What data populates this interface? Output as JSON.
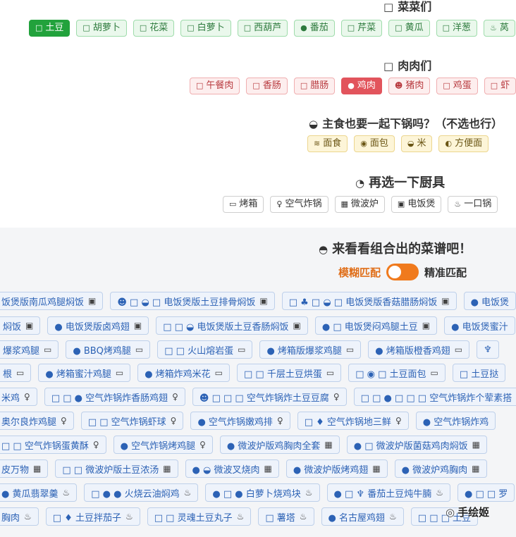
{
  "vegetables": {
    "title": "菜菜们",
    "title_icon": "□",
    "items": [
      {
        "label": "土豆",
        "icon": "□",
        "active": true
      },
      {
        "label": "胡萝卜",
        "icon": "□"
      },
      {
        "label": "花菜",
        "icon": "□"
      },
      {
        "label": "白萝卜",
        "icon": "□"
      },
      {
        "label": "西葫芦",
        "icon": "□"
      },
      {
        "label": "番茄",
        "icon": "●"
      },
      {
        "label": "芹菜",
        "icon": "□"
      },
      {
        "label": "黄瓜",
        "icon": "□"
      },
      {
        "label": "洋葱",
        "icon": "□"
      },
      {
        "label": "莴",
        "icon": "♨"
      }
    ]
  },
  "meats": {
    "title": "肉肉们",
    "title_icon": "□",
    "items": [
      {
        "label": "午餐肉",
        "icon": "□"
      },
      {
        "label": "香肠",
        "icon": "□"
      },
      {
        "label": "腊肠",
        "icon": "□"
      },
      {
        "label": "鸡肉",
        "icon": "●",
        "active": true
      },
      {
        "label": "猪肉",
        "icon": "☻"
      },
      {
        "label": "鸡蛋",
        "icon": "□"
      },
      {
        "label": "虾",
        "icon": "□"
      }
    ]
  },
  "staples": {
    "title": "主食也要一起下锅吗？（不选也行）",
    "title_icon": "◒",
    "items": [
      {
        "label": "面食",
        "icon": "≋"
      },
      {
        "label": "面包",
        "icon": "◉"
      },
      {
        "label": "米",
        "icon": "◒"
      },
      {
        "label": "方便面",
        "icon": "◐"
      }
    ]
  },
  "tools": {
    "title": "再选一下厨具",
    "title_icon": "◔",
    "items": [
      {
        "label": "烤箱",
        "icon": "▭"
      },
      {
        "label": "空气炸锅",
        "icon": "♀"
      },
      {
        "label": "微波炉",
        "icon": "▦"
      },
      {
        "label": "电饭煲",
        "icon": "▣"
      },
      {
        "label": "一口锅",
        "icon": "♨"
      }
    ]
  },
  "results": {
    "title": "来看看组合出的菜谱吧！",
    "title_icon": "◓",
    "toggle_left": "模糊匹配",
    "toggle_right": "精准匹配",
    "rows": [
      [
        {
          "label": "饭煲版南瓜鸡腿焖饭",
          "tail": "▣"
        },
        {
          "label": "☻ □ ◒ □ 电饭煲版土豆排骨焖饭",
          "tail": "▣"
        },
        {
          "label": "□ ♣ □ ◒ □ 电饭煲版香菇腊肠焖饭",
          "tail": "▣"
        },
        {
          "label": "● 电饭煲",
          "tail": ""
        }
      ],
      [
        {
          "label": "焖饭",
          "tail": "▣"
        },
        {
          "label": "● 电饭煲版卤鸡翅",
          "tail": "▣"
        },
        {
          "label": "□ □ ◒ 电饭煲版土豆香肠焖饭",
          "tail": "▣"
        },
        {
          "label": "● □ 电饭煲闷鸡腿土豆",
          "tail": "▣"
        },
        {
          "label": "● 电饭煲蜜汁",
          "tail": ""
        }
      ],
      [
        {
          "label": "爆浆鸡腿",
          "tail": "▭"
        },
        {
          "label": "● BBQ烤鸡腿",
          "tail": "▭"
        },
        {
          "label": "□ □ 火山熔岩蛋",
          "tail": "▭"
        },
        {
          "label": "● 烤箱版爆浆鸡腿",
          "tail": "▭"
        },
        {
          "label": "● 烤箱版橙香鸡翅",
          "tail": "▭"
        },
        {
          "label": "♆",
          "tail": ""
        }
      ],
      [
        {
          "label": "根",
          "tail": "▭"
        },
        {
          "label": "● 烤箱蜜汁鸡腿",
          "tail": "▭"
        },
        {
          "label": "● 烤箱炸鸡米花",
          "tail": "▭"
        },
        {
          "label": "□ □ 千层土豆烘蛋",
          "tail": "▭"
        },
        {
          "label": "□ ◉ □ 土豆面包",
          "tail": "▭"
        },
        {
          "label": "□ 土豆挞",
          "tail": ""
        }
      ],
      [
        {
          "label": "米鸡",
          "tail": "♀"
        },
        {
          "label": "□ □ ● 空气炸锅炸香肠鸡翅",
          "tail": "♀"
        },
        {
          "label": "☻ □ □ □ 空气炸锅炸土豆豆腐",
          "tail": "♀"
        },
        {
          "label": "□ □ ● □ □ □ 空气炸锅炸个荤素搭",
          "tail": ""
        }
      ],
      [
        {
          "label": "奥尔良炸鸡腿",
          "tail": "♀"
        },
        {
          "label": "□ □ 空气炸锅虾球",
          "tail": "♀"
        },
        {
          "label": "● 空气炸锅嫩鸡排",
          "tail": "♀"
        },
        {
          "label": "□ ♦ 空气炸锅地三鲜",
          "tail": "♀"
        },
        {
          "label": "● 空气炸锅炸鸡",
          "tail": ""
        }
      ],
      [
        {
          "label": "□ □ 空气炸锅蛋黄酥",
          "tail": "♀"
        },
        {
          "label": "● 空气炸锅烤鸡腿",
          "tail": "♀"
        },
        {
          "label": "● 微波炉版鸡胸肉全套",
          "tail": "▦"
        },
        {
          "label": "● □ 微波炉版菌菇鸡肉焖饭",
          "tail": "▦"
        }
      ],
      [
        {
          "label": "皮万物",
          "tail": "▦"
        },
        {
          "label": "□ □ 微波炉版土豆浓汤",
          "tail": "▦"
        },
        {
          "label": "● ◒ 微波叉烧肉",
          "tail": "▦"
        },
        {
          "label": "● 微波炉版烤鸡翅",
          "tail": "▦"
        },
        {
          "label": "● 微波炉鸡胸肉",
          "tail": "▦"
        }
      ],
      [
        {
          "label": "● 黄瓜翡翠羹",
          "tail": "♨"
        },
        {
          "label": "□ ● ● 火烧云油焖鸡",
          "tail": "♨"
        },
        {
          "label": "● □ ● 白萝卜烧鸡块",
          "tail": "♨"
        },
        {
          "label": "● □ ♆ 番茄土豆炖牛腩",
          "tail": "♨"
        },
        {
          "label": "● □ □ 罗",
          "tail": ""
        }
      ],
      [
        {
          "label": "胸肉",
          "tail": "♨"
        },
        {
          "label": "□ ♦ 土豆拌茄子",
          "tail": "♨"
        },
        {
          "label": "□ □ 灵魂土豆丸子",
          "tail": "♨"
        },
        {
          "label": "□ 薯塔",
          "tail": "♨"
        },
        {
          "label": "● 名古屋鸡翅",
          "tail": "♨"
        },
        {
          "label": "□ □ □ 土豆",
          "tail": ""
        }
      ]
    ]
  },
  "watermark": {
    "logo": "◎",
    "text": "手绘姬"
  }
}
